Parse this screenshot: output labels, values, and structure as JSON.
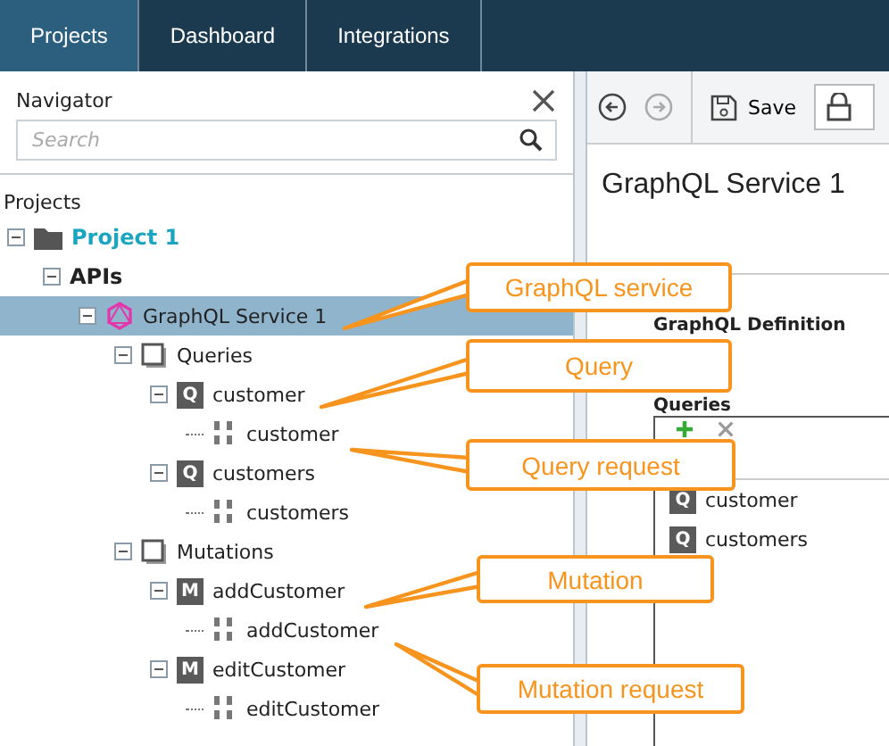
{
  "top_tabs": [
    {
      "label": "Projects",
      "selected": true
    },
    {
      "label": "Dashboard",
      "selected": false
    },
    {
      "label": "Integrations",
      "selected": false
    }
  ],
  "navigator": {
    "title": "Navigator",
    "search": {
      "placeholder": "Search"
    },
    "section": "Projects",
    "tree": [
      {
        "label": "Project 1",
        "kind": "project",
        "expanded": true,
        "selected": false,
        "children": [
          {
            "label": "APIs",
            "kind": "group",
            "expanded": true,
            "selected": false,
            "children": [
              {
                "label": "GraphQL Service 1",
                "kind": "service",
                "expanded": true,
                "selected": true,
                "children": [
                  {
                    "label": "Queries",
                    "kind": "category",
                    "expanded": true,
                    "selected": false,
                    "children": [
                      {
                        "label": "customer",
                        "kind": "operation",
                        "badge": "Q",
                        "expanded": true,
                        "selected": false,
                        "children": [
                          {
                            "label": "customer",
                            "kind": "request",
                            "selected": false
                          }
                        ]
                      },
                      {
                        "label": "customers",
                        "kind": "operation",
                        "badge": "Q",
                        "expanded": true,
                        "selected": false,
                        "children": [
                          {
                            "label": "customers",
                            "kind": "request",
                            "selected": false
                          }
                        ]
                      }
                    ]
                  },
                  {
                    "label": "Mutations",
                    "kind": "category",
                    "expanded": true,
                    "selected": false,
                    "children": [
                      {
                        "label": "addCustomer",
                        "kind": "operation",
                        "badge": "M",
                        "expanded": true,
                        "selected": false,
                        "children": [
                          {
                            "label": "addCustomer",
                            "kind": "request",
                            "selected": false
                          }
                        ]
                      },
                      {
                        "label": "editCustomer",
                        "kind": "operation",
                        "badge": "M",
                        "expanded": true,
                        "selected": false,
                        "children": [
                          {
                            "label": "editCustomer",
                            "kind": "request",
                            "selected": false
                          }
                        ]
                      }
                    ]
                  }
                ]
              }
            ]
          }
        ]
      }
    ]
  },
  "editor": {
    "toolbar": {
      "save": "Save",
      "forward_disabled": true
    },
    "title": "GraphQL Service 1",
    "section": "GraphQL Definition",
    "list_title": "Queries",
    "items": [
      {
        "label": "customer",
        "kind": "operation",
        "badge": "Q"
      },
      {
        "label": "customers",
        "kind": "operation",
        "badge": "Q"
      }
    ]
  },
  "callouts": [
    "GraphQL service",
    "Query",
    "Query request",
    "Mutation",
    "Mutation request"
  ]
}
